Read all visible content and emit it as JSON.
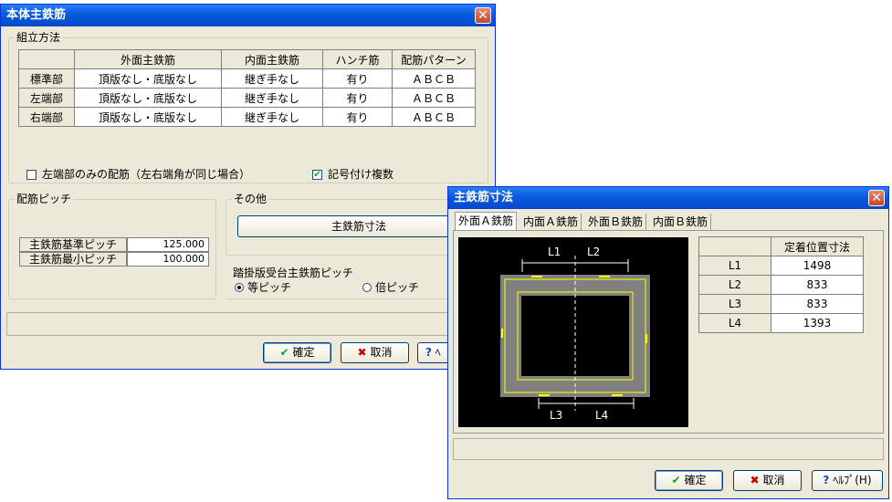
{
  "main": {
    "title": "本体主鉄筋",
    "assembly": {
      "group_title": "組立方法",
      "headers": [
        "",
        "外面主鉄筋",
        "内面主鉄筋",
        "ハンチ筋",
        "配筋パターン"
      ],
      "rows": [
        [
          "標準部",
          "頂版なし・底版なし",
          "継ぎ手なし",
          "有り",
          "ＡＢＣＢ"
        ],
        [
          "左端部",
          "頂版なし・底版なし",
          "継ぎ手なし",
          "有り",
          "ＡＢＣＢ"
        ],
        [
          "右端部",
          "頂版なし・底版なし",
          "継ぎ手なし",
          "有り",
          "ＡＢＣＢ"
        ]
      ],
      "left_only_label": "左端部のみの配筋（左右端角が同じ場合）",
      "left_only_checked": false,
      "symbol_multi_label": "記号付け複数",
      "symbol_multi_checked": true
    },
    "pitch": {
      "group_title": "配筋ピッチ",
      "base_label": "主鉄筋基準ピッチ",
      "base_value": "125.000",
      "min_label": "主鉄筋最小ピッチ",
      "min_value": "100.000"
    },
    "other": {
      "group_title": "その他",
      "dim_button": "主鉄筋寸法"
    },
    "step_pitch": {
      "group_title": "踏掛版受台主鉄筋ピッチ",
      "equal_label": "等ピッチ",
      "double_label": "倍ピッチ",
      "selected": "equal"
    },
    "ok_label": "確定",
    "cancel_label": "取消",
    "help_label": "ﾍ"
  },
  "sub": {
    "title": "主鉄筋寸法",
    "tabs": [
      "外面Ａ鉄筋",
      "内面Ａ鉄筋",
      "外面Ｂ鉄筋",
      "内面Ｂ鉄筋"
    ],
    "active_tab": 0,
    "diagram_labels": {
      "l1": "L1",
      "l2": "L2",
      "l3": "L3",
      "l4": "L4"
    },
    "table": {
      "header": "定着位置寸法",
      "rows": [
        {
          "label": "L1",
          "value": "1498"
        },
        {
          "label": "L2",
          "value": "833"
        },
        {
          "label": "L3",
          "value": "833"
        },
        {
          "label": "L4",
          "value": "1393"
        }
      ]
    },
    "ok_label": "確定",
    "cancel_label": "取消",
    "help_label": "ﾍﾙﾌﾟ(H)"
  },
  "colors": {
    "titlebar": "#0a5ddf",
    "diagram_bg": "#000000",
    "concrete": "#808080",
    "rebar": "#ffff00"
  }
}
